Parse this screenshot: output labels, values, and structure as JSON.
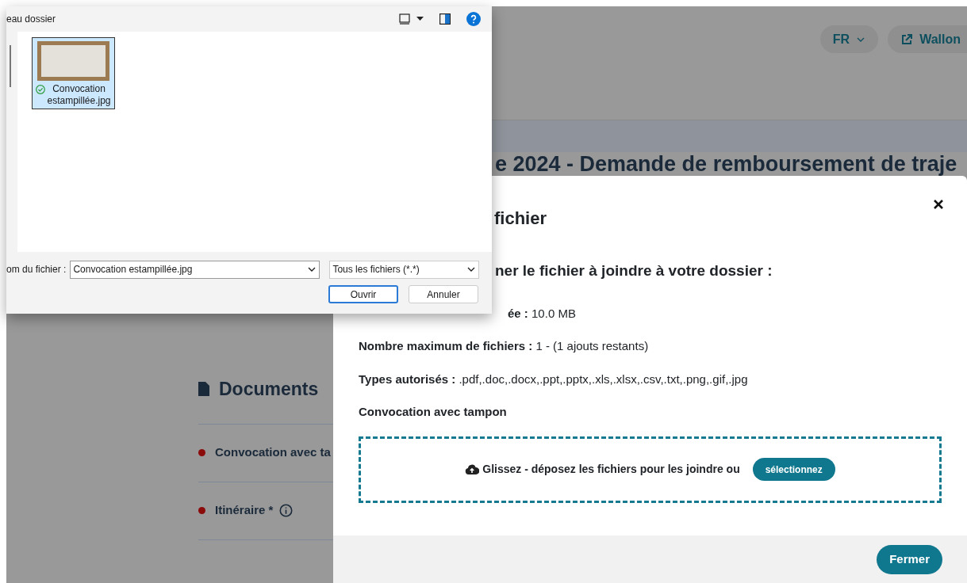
{
  "page": {
    "header": {
      "language": "FR",
      "link": "Wallon"
    },
    "title": "e 2024 - Demande de remboursement de traje",
    "section": {
      "title": "Documents",
      "items": [
        {
          "label": "Convocation avec ta",
          "info": false
        },
        {
          "label": "Itinéraire",
          "marker": "*",
          "info": true
        }
      ]
    }
  },
  "modal": {
    "title": "fichier",
    "heading": "ner le fichier à joindre à votre dossier :",
    "facts": [
      "**ée :** 10.0 MB",
      "**Nombre maximum de fichiers :** 1 - (1 ajouts restants)",
      "**Types autorisés :** .pdf,.doc,.docx,.ppt,.pptx,.xls,.xlsx,.csv,.txt,.png,.gif,.jpg"
    ],
    "document_label": "Convocation avec tampon",
    "dropzone": {
      "text": "Glissez - déposez les fichiers pour les joindre ou",
      "button": "sélectionnez"
    },
    "footer_button": "Fermer"
  },
  "dialog": {
    "title": "eau dossier",
    "files": [
      {
        "name": "Convocation estampillée.jpg",
        "selected": true,
        "synced": true
      }
    ],
    "filename_label": "om du fichier :",
    "filename": "Convocation estampillée.jpg",
    "file_type": "Tous les fichiers (*.*)",
    "buttons": [
      {
        "label": "Ouvrir",
        "default": true
      },
      {
        "label": "Annuler",
        "default": false
      }
    ]
  }
}
